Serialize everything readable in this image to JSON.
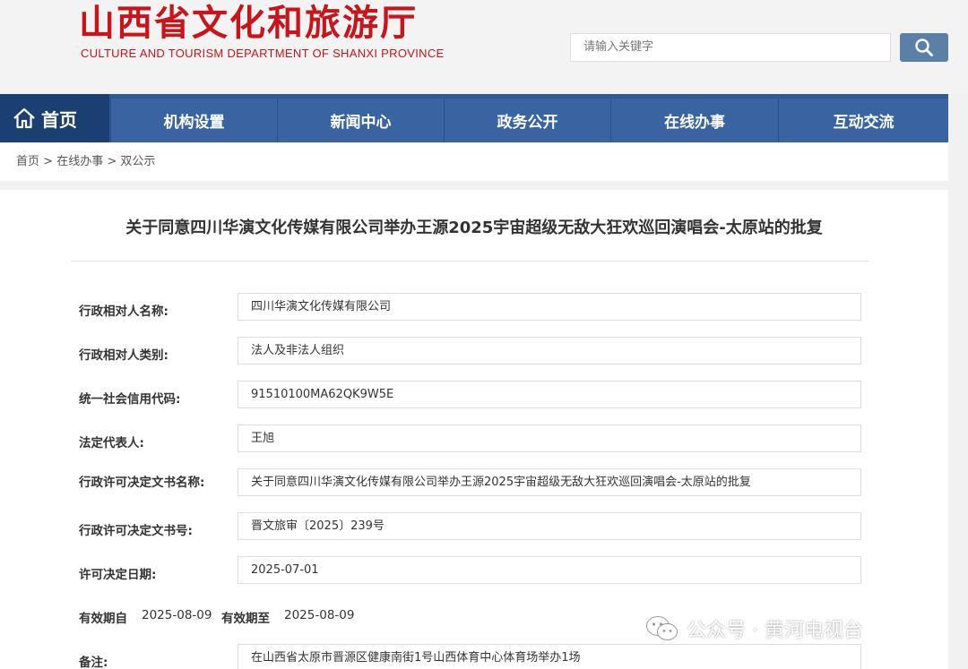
{
  "header": {
    "logo_cn": "山西省文化和旅游厅",
    "logo_en": "CULTURE AND TOURISM DEPARTMENT OF SHANXI PROVINCE",
    "search_placeholder": "请输入关键字"
  },
  "nav": {
    "home": "首页",
    "items": [
      "机构设置",
      "新闻中心",
      "政务公开",
      "在线办事",
      "互动交流"
    ]
  },
  "breadcrumb": [
    "首页",
    "在线办事",
    "双公示"
  ],
  "breadcrumb_sep": ">",
  "doc": {
    "title": "关于同意四川华演文化传媒有限公司举办王源2025宇宙超级无敌大狂欢巡回演唱会-太原站的批复",
    "rows": [
      {
        "label": "行政相对人名称:",
        "value": "四川华演文化传媒有限公司"
      },
      {
        "label": "行政相对人类别:",
        "value": "法人及非法人组织"
      },
      {
        "label": "统一社会信用代码:",
        "value": "91510100MA62QK9W5E"
      },
      {
        "label": "法定代表人:",
        "value": "王旭"
      },
      {
        "label": "行政许可决定文书名称:",
        "value": "关于同意四川华演文化传媒有限公司举办王源2025宇宙超级无敌大狂欢巡回演唱会-太原站的批复"
      },
      {
        "label": "行政许可决定文书号:",
        "value": "晋文旅审〔2025〕239号"
      },
      {
        "label": "许可决定日期:",
        "value": "2025-07-01"
      }
    ],
    "validity": {
      "from_label": "有效期自",
      "from_value": "2025-08-09",
      "to_label": "有效期至",
      "to_value": "2025-08-09"
    },
    "remark": {
      "label": "备注:",
      "value": "在山西省太原市晋源区健康南街1号山西体育中心体育场举办1场"
    }
  },
  "watermark": "公众号 · 黄河电视台",
  "colors": {
    "brand_red": "#c8151b",
    "nav_blue": "#2f5a96",
    "nav_home": "#1c3f73",
    "search_btn": "#5b7fa6"
  }
}
